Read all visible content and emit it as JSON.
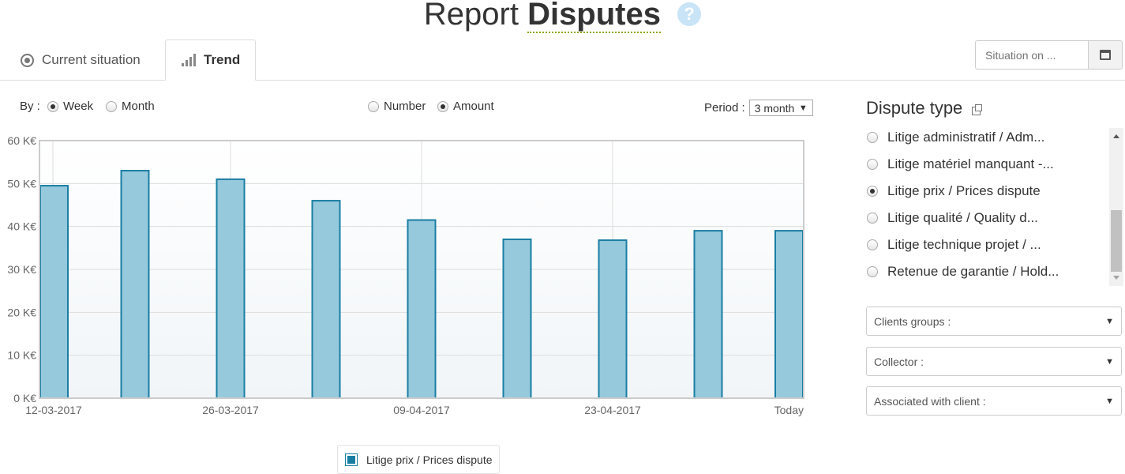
{
  "header": {
    "title_light": "Report",
    "title_bold": "Disputes",
    "help_icon": "?"
  },
  "tabs": [
    {
      "label": "Current situation",
      "icon": "target-icon"
    },
    {
      "label": "Trend",
      "icon": "bar-chart-icon",
      "active": true
    }
  ],
  "situation": {
    "placeholder": "Situation on ...",
    "icon": "calendar-icon"
  },
  "controls": {
    "by_label": "By :",
    "by_options": [
      {
        "label": "Week",
        "selected": true
      },
      {
        "label": "Month",
        "selected": false
      }
    ],
    "measure_options": [
      {
        "label": "Number",
        "selected": false
      },
      {
        "label": "Amount",
        "selected": true
      }
    ],
    "period_label": "Period :",
    "period_value": "3 month",
    "period_caret": "▼"
  },
  "chart_data": {
    "type": "bar",
    "categories": [
      "12-03-2017",
      "",
      "26-03-2017",
      "",
      "09-04-2017",
      "",
      "23-04-2017",
      "",
      "Today"
    ],
    "series": [
      {
        "name": "Litige prix / Prices dispute",
        "values": [
          49.5,
          53,
          51,
          46,
          41.5,
          37,
          36.8,
          39,
          39
        ]
      }
    ],
    "ylim": [
      0,
      60
    ],
    "yticks": [
      0,
      10,
      20,
      30,
      40,
      50,
      60
    ],
    "ytick_labels": [
      "0 K€",
      "10 K€",
      "20 K€",
      "30 K€",
      "40 K€",
      "50 K€",
      "60 K€"
    ],
    "xtick_labels": [
      "12-03-2017",
      "26-03-2017",
      "09-04-2017",
      "23-04-2017",
      "Today"
    ],
    "grid": true,
    "legend": "bottom-center",
    "colors": {
      "bar_fill": "#96c9dc",
      "bar_stroke": "#1a7ea3"
    }
  },
  "legend": {
    "label": "Litige prix / Prices dispute",
    "color": "#1a7ea3"
  },
  "dispute_type": {
    "title": "Dispute type",
    "items": [
      {
        "label": "Litige administratif / Adm...",
        "selected": false
      },
      {
        "label": "Litige matériel manquant -...",
        "selected": false
      },
      {
        "label": "Litige prix / Prices dispute",
        "selected": true
      },
      {
        "label": "Litige qualité / Quality d...",
        "selected": false
      },
      {
        "label": "Litige technique projet / ...",
        "selected": false
      },
      {
        "label": "Retenue de garantie / Hold...",
        "selected": false
      }
    ]
  },
  "filters": [
    {
      "label": "Clients groups :",
      "caret": "▼"
    },
    {
      "label": "Collector :",
      "caret": "▼"
    },
    {
      "label": "Associated with client :",
      "caret": "▼"
    }
  ]
}
